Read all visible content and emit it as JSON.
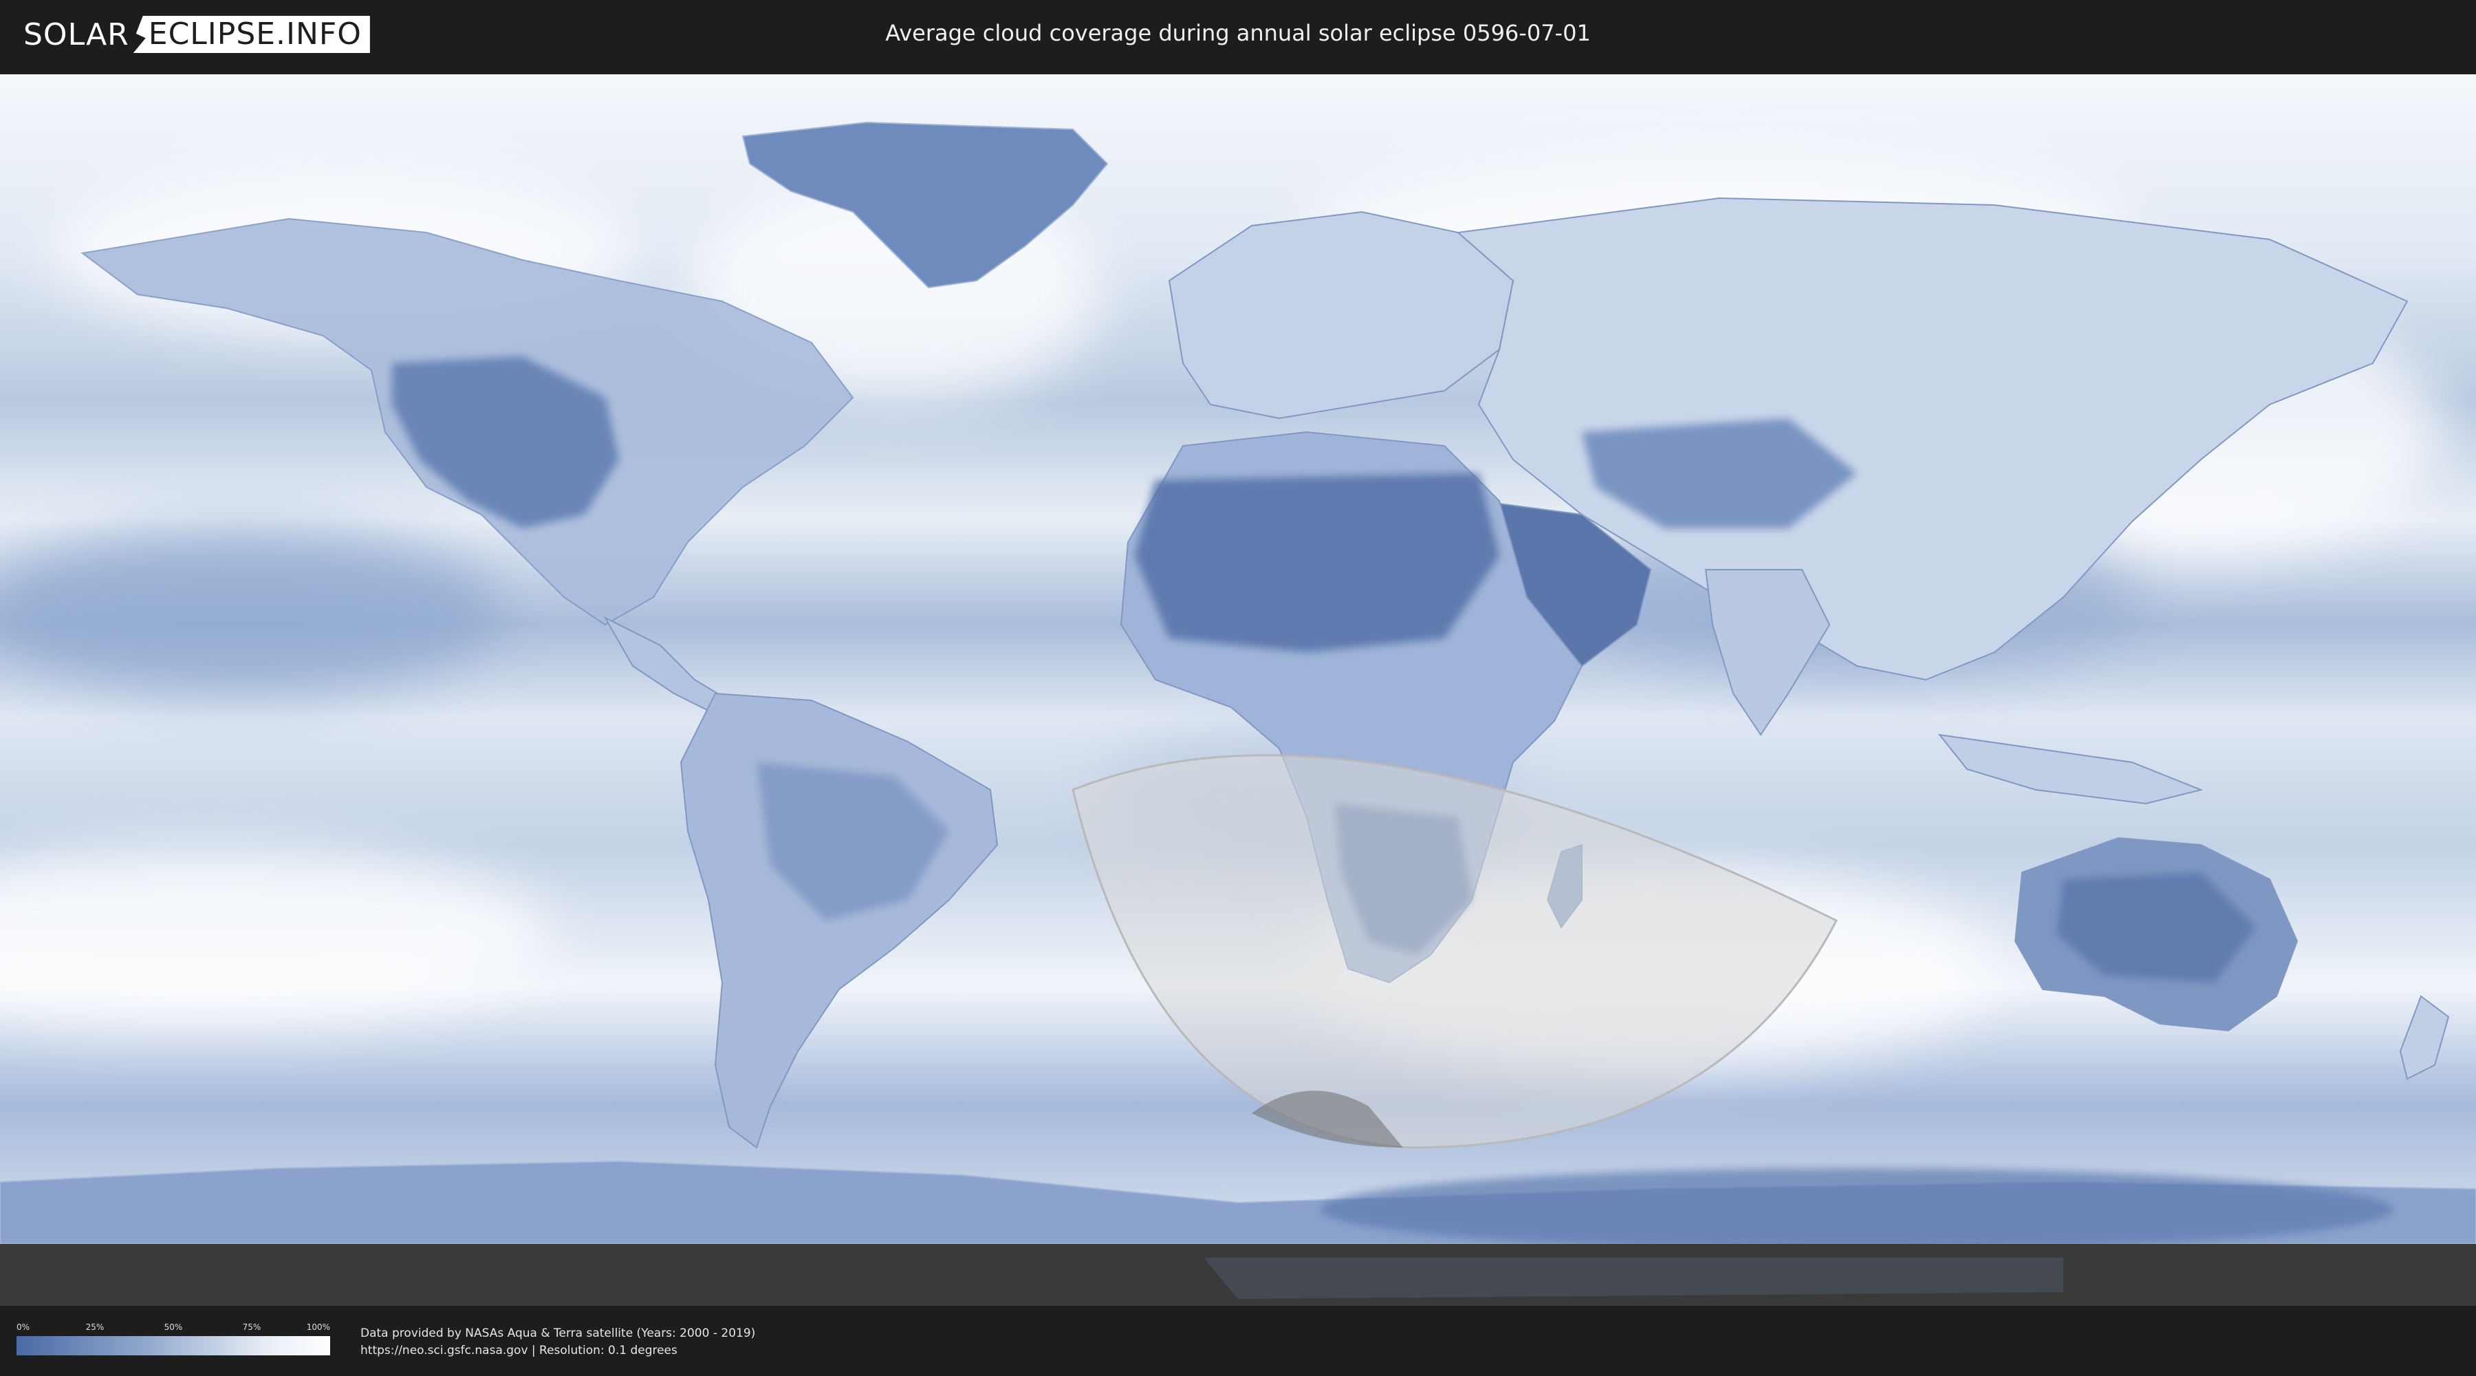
{
  "header": {
    "logo_left": "SOLAR",
    "logo_right": "ECLIPSE.INFO",
    "title": "Average cloud coverage during annual solar eclipse 0596-07-01"
  },
  "map": {
    "colors": {
      "ocean_clear": "#4a6aa5",
      "cloud": "#eef3f9",
      "land_clear": "#5d77a8",
      "eclipse_overlay": "#d9d9d9",
      "no_data": "#3a3a3a"
    }
  },
  "legend": {
    "ticks": [
      "0%",
      "25%",
      "50%",
      "75%",
      "100%"
    ]
  },
  "footer": {
    "credit_line_1": "Data provided by NASAs Aqua & Terra satellite (Years: 2000 - 2019)",
    "credit_line_2": "https://neo.sci.gsfc.nasa.gov | Resolution: 0.1 degrees"
  }
}
